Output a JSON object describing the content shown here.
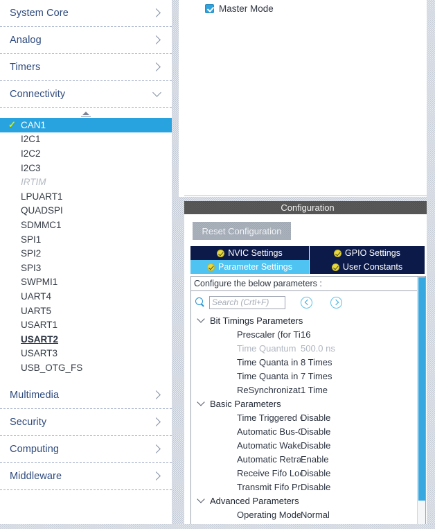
{
  "sidebar": {
    "top_categories": [
      {
        "label": "System Core",
        "icon": "chevron-right-icon",
        "expanded": false
      },
      {
        "label": "Analog",
        "icon": "chevron-right-icon",
        "expanded": false
      },
      {
        "label": "Timers",
        "icon": "chevron-right-icon",
        "expanded": false
      },
      {
        "label": "Connectivity",
        "icon": "chevron-down-icon",
        "expanded": true
      }
    ],
    "scroll_up_indicator": "scroll-up-icon",
    "peripherals": [
      {
        "label": "CAN1",
        "state": "selected",
        "check": "✓"
      },
      {
        "label": "I2C1",
        "state": "normal"
      },
      {
        "label": "I2C2",
        "state": "normal"
      },
      {
        "label": "I2C3",
        "state": "normal"
      },
      {
        "label": "IRTIM",
        "state": "disabled"
      },
      {
        "label": "LPUART1",
        "state": "normal"
      },
      {
        "label": "QUADSPI",
        "state": "normal"
      },
      {
        "label": "SDMMC1",
        "state": "normal"
      },
      {
        "label": "SPI1",
        "state": "normal"
      },
      {
        "label": "SPI2",
        "state": "normal"
      },
      {
        "label": "SPI3",
        "state": "normal"
      },
      {
        "label": "SWPMI1",
        "state": "normal"
      },
      {
        "label": "UART4",
        "state": "normal"
      },
      {
        "label": "UART5",
        "state": "normal"
      },
      {
        "label": "USART1",
        "state": "normal"
      },
      {
        "label": "USART2",
        "state": "hovered"
      },
      {
        "label": "USART3",
        "state": "normal"
      },
      {
        "label": "USB_OTG_FS",
        "state": "normal"
      }
    ],
    "bottom_categories": [
      {
        "label": "Multimedia",
        "icon": "chevron-right-icon",
        "expanded": false
      },
      {
        "label": "Security",
        "icon": "chevron-right-icon",
        "expanded": false
      },
      {
        "label": "Computing",
        "icon": "chevron-right-icon",
        "expanded": false
      },
      {
        "label": "Middleware",
        "icon": "chevron-right-icon",
        "expanded": false
      }
    ]
  },
  "mode_panel": {
    "master_mode": {
      "label": "Master Mode",
      "checked": true,
      "icon": "checkbox-checked-icon"
    }
  },
  "configuration": {
    "header_title": "Configuration",
    "reset_button": "Reset Configuration",
    "tabs": [
      {
        "label": "NVIC Settings",
        "active": false,
        "badge": "check-badge-icon"
      },
      {
        "label": "GPIO Settings",
        "active": false,
        "badge": "check-badge-icon"
      },
      {
        "label": "Parameter Settings",
        "active": true,
        "badge": "check-badge-icon"
      },
      {
        "label": "User Constants",
        "active": false,
        "badge": "check-badge-icon"
      }
    ],
    "hint": "Configure the below parameters :",
    "search": {
      "placeholder": "Search (Crtl+F)",
      "value": "",
      "icon": "search-icon",
      "back_icon": "nav-back-icon",
      "forward_icon": "nav-forward-icon"
    },
    "groups": [
      {
        "name": "Bit Timings Parameters",
        "expanded": true,
        "rows": [
          {
            "name": "Prescaler (for Time Quant...",
            "value": "16",
            "disabled": false
          },
          {
            "name": "Time Quantum",
            "value": "500.0 ns",
            "disabled": true
          },
          {
            "name": "Time Quanta in Bit Segm...",
            "value": "8 Times",
            "disabled": false
          },
          {
            "name": "Time Quanta in Bit Segm...",
            "value": "7 Times",
            "disabled": false
          },
          {
            "name": "ReSynchronization Jump ...",
            "value": "1 Time",
            "disabled": false
          }
        ]
      },
      {
        "name": "Basic Parameters",
        "expanded": true,
        "rows": [
          {
            "name": "Time Triggered Communi...",
            "value": "Disable",
            "disabled": false
          },
          {
            "name": "Automatic Bus-Off Manag...",
            "value": "Disable",
            "disabled": false
          },
          {
            "name": "Automatic Wake-Up Mode",
            "value": "Disable",
            "disabled": false
          },
          {
            "name": "Automatic Retransmission",
            "value": "Enable",
            "disabled": false
          },
          {
            "name": "Receive Fifo Locked Mode",
            "value": "Disable",
            "disabled": false
          },
          {
            "name": "Transmit Fifo Priority",
            "value": "Disable",
            "disabled": false
          }
        ]
      },
      {
        "name": "Advanced Parameters",
        "expanded": true,
        "rows": [
          {
            "name": "Operating Mode",
            "value": "Normal",
            "disabled": false
          }
        ]
      }
    ]
  },
  "colors": {
    "selection_blue": "#29a3e0",
    "tab_active": "#4fc3f1",
    "tab_inactive": "#0c1a4a",
    "category_text": "#2e4a7d",
    "scrollbar_thumb": "#38a8e0",
    "config_header_bg": "#4f4f4f"
  }
}
